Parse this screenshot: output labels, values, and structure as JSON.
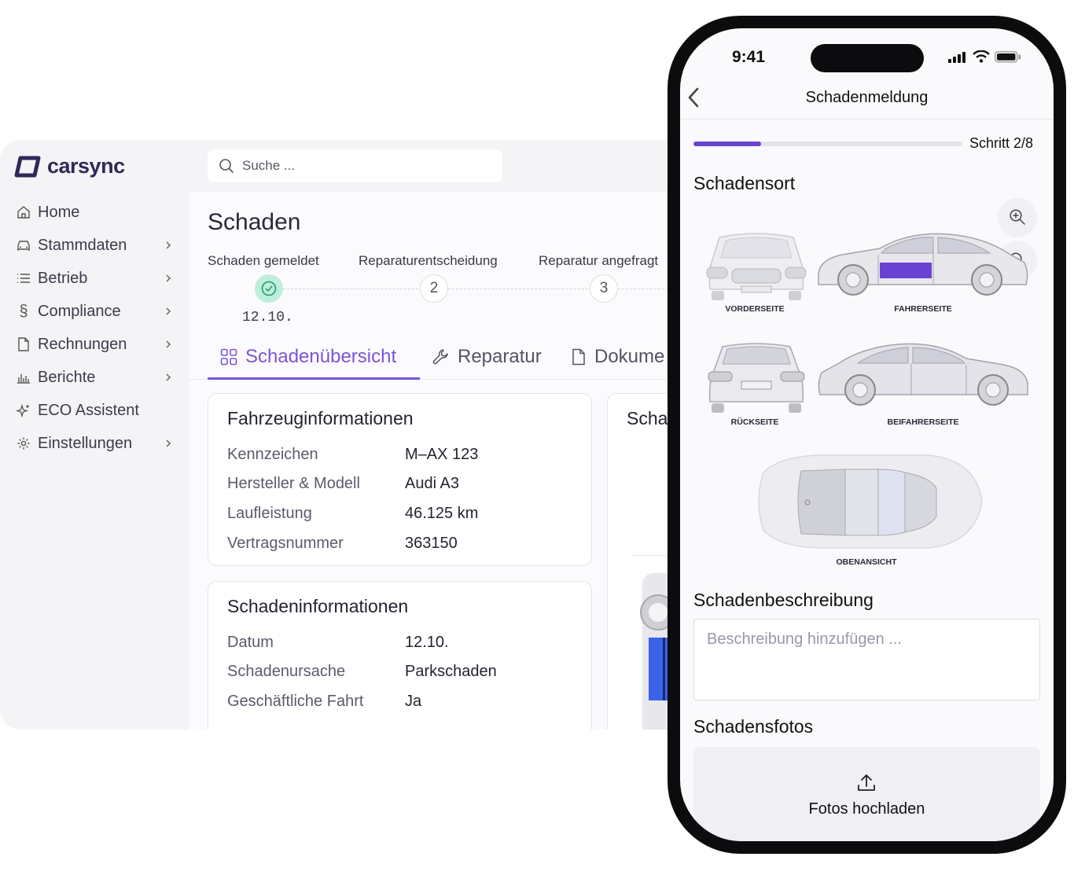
{
  "app": {
    "brand": "carsync",
    "search_placeholder": "Suche ..."
  },
  "sidebar": {
    "items": [
      {
        "label": "Home",
        "icon": "home-icon",
        "has_submenu": false
      },
      {
        "label": "Stammdaten",
        "icon": "car-icon",
        "has_submenu": true
      },
      {
        "label": "Betrieb",
        "icon": "list-icon",
        "has_submenu": true
      },
      {
        "label": "Compliance",
        "icon": "paragraph-icon",
        "has_submenu": true
      },
      {
        "label": "Rechnungen",
        "icon": "document-icon",
        "has_submenu": true
      },
      {
        "label": "Berichte",
        "icon": "bar-chart-icon",
        "has_submenu": true
      },
      {
        "label": "ECO Assistent",
        "icon": "sparkle-icon",
        "has_submenu": false
      },
      {
        "label": "Einstellungen",
        "icon": "gear-icon",
        "has_submenu": true
      }
    ]
  },
  "page": {
    "title": "Schaden",
    "steps": [
      {
        "label": "Schaden gemeldet",
        "marker": "",
        "done": true,
        "date": "12.10."
      },
      {
        "label": "Reparaturentscheidung",
        "marker": "2",
        "done": false
      },
      {
        "label": "Reparatur angefragt",
        "marker": "3",
        "done": false
      }
    ],
    "tabs": [
      {
        "label": "Schadenübersicht",
        "icon": "grid-icon",
        "active": true
      },
      {
        "label": "Reparatur",
        "icon": "wrench-icon",
        "active": false
      },
      {
        "label": "Dokume",
        "icon": "document-icon",
        "active": false
      }
    ],
    "vehicle_card": {
      "title": "Fahrzeuginformationen",
      "rows": [
        {
          "label": "Kennzeichen",
          "value": "M–AX 123"
        },
        {
          "label": "Hersteller & Modell",
          "value": "Audi A3"
        },
        {
          "label": "Laufleistung",
          "value": "46.125 km"
        },
        {
          "label": "Vertragsnummer",
          "value": "363150"
        }
      ]
    },
    "damage_card": {
      "title": "Schadeninformationen",
      "rows": [
        {
          "label": "Datum",
          "value": "12.10."
        },
        {
          "label": "Schadenursache",
          "value": "Parkschaden"
        },
        {
          "label": "Geschäftliche Fahrt",
          "value": "Ja"
        }
      ]
    },
    "side_card_title": "Scha"
  },
  "phone": {
    "time": "9:41",
    "title": "Schadenmeldung",
    "progress_fraction": 0.25,
    "step_counter": "Schritt 2/8",
    "section_damage_location": "Schadensort",
    "views": [
      {
        "label": "VORDERSEITE"
      },
      {
        "label": "FAHRERSEITE",
        "highlighted_area": "driver door"
      },
      {
        "label": "RÜCKSEITE"
      },
      {
        "label": "BEIFAHRERSEITE"
      },
      {
        "label": "OBENANSICHT"
      }
    ],
    "section_description": "Schadenbeschreibung",
    "description_placeholder": "Beschreibung hinzufügen ...",
    "section_photos": "Schadensfotos",
    "upload_label": "Fotos hochladen",
    "colors": {
      "accent": "#6b45d0",
      "success": "#bfeedd",
      "highlight": "#6a42d2"
    }
  }
}
